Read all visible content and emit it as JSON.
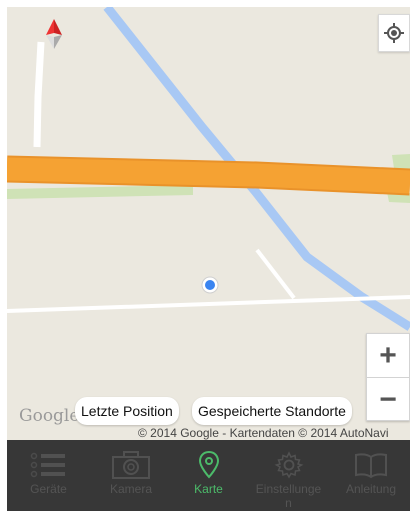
{
  "map": {
    "logo": "Google",
    "copyright": "© 2014 Google - Kartendaten © 2014 AutoNavi",
    "zoom_in": "+",
    "zoom_out": "−",
    "colors": {
      "land": "#ebe8df",
      "highway": "#f5a131",
      "river": "#a6c6f5",
      "minor_road": "#ffffff",
      "park": "#c9dfb0"
    }
  },
  "chips": {
    "last_position": "Letzte Position",
    "saved_locations": "Gespeicherte Standorte"
  },
  "tabbar": {
    "active_color": "#4cbb6a",
    "items": [
      {
        "label": "Geräte",
        "icon": "list-icon"
      },
      {
        "label": "Kamera",
        "icon": "camera-icon"
      },
      {
        "label": "Karte",
        "icon": "map-pin-icon"
      },
      {
        "label": "Einstellungen",
        "label_line1": "Einstellunge",
        "label_line2": "n",
        "icon": "gear-icon"
      },
      {
        "label": "Anleitung",
        "icon": "book-icon"
      }
    ]
  }
}
